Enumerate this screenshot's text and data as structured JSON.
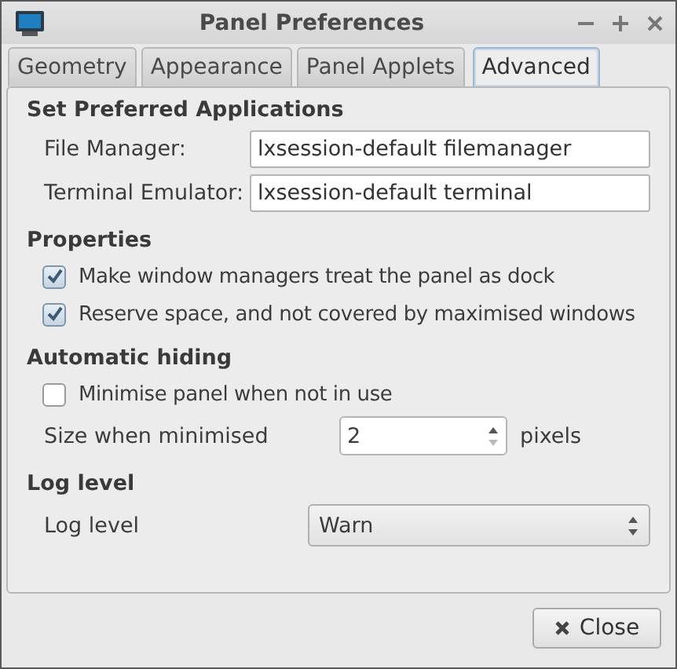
{
  "window": {
    "title": "Panel Preferences"
  },
  "tabs": [
    {
      "label": "Geometry",
      "selected": false
    },
    {
      "label": "Appearance",
      "selected": false
    },
    {
      "label": "Panel Applets",
      "selected": false
    },
    {
      "label": "Advanced",
      "selected": true
    }
  ],
  "sections": [
    {
      "title": "Set Preferred Applications",
      "rows": [
        {
          "kind": "text",
          "label": "File Manager:",
          "value": "lxsession-default filemanager"
        },
        {
          "kind": "text",
          "label": "Terminal Emulator:",
          "value": "lxsession-default terminal"
        }
      ]
    },
    {
      "title": "Properties",
      "rows": [
        {
          "kind": "checkbox",
          "label": "Make window managers treat the panel as dock",
          "checked": true
        },
        {
          "kind": "checkbox",
          "label": "Reserve space, and not covered by maximised windows",
          "checked": true
        }
      ]
    },
    {
      "title": "Automatic hiding",
      "rows": [
        {
          "kind": "checkbox",
          "label": "Minimise panel when not in use",
          "checked": false
        },
        {
          "kind": "spin",
          "label": "Size when minimised",
          "value": "2",
          "unit": "pixels"
        }
      ]
    },
    {
      "title": "Log level",
      "rows": [
        {
          "kind": "combo",
          "label": "Log level",
          "value": "Warn"
        }
      ]
    }
  ],
  "buttons": [
    {
      "label": "Close"
    }
  ]
}
